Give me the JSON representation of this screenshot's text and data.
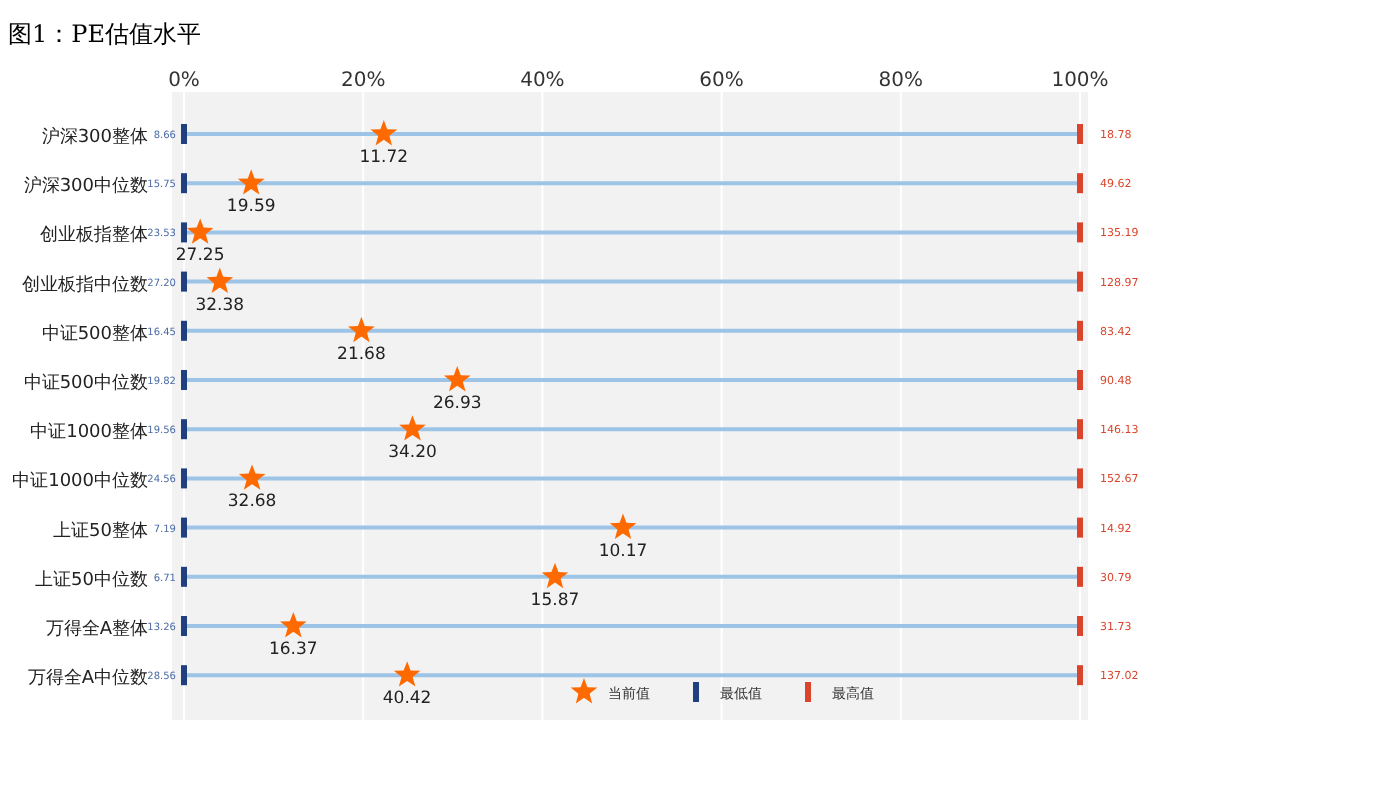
{
  "figure_title": "图1：PE估值水平",
  "chart_data": {
    "type": "scatter",
    "orientation": "horizontal",
    "grid": true,
    "legend": true,
    "xlim": [
      0,
      100
    ],
    "xticks": [
      {
        "value": 0,
        "label": "0%"
      },
      {
        "value": 20,
        "label": "20%"
      },
      {
        "value": 40,
        "label": "40%"
      },
      {
        "value": 60,
        "label": "60%"
      },
      {
        "value": 80,
        "label": "80%"
      },
      {
        "value": 100,
        "label": "100%"
      }
    ],
    "categories": [
      "沪深300整体",
      "沪深300中位数",
      "创业板指整体",
      "创业板指中位数",
      "中证500整体",
      "中证500中位数",
      "中证1000整体",
      "中证1000中位数",
      "上证50整体",
      "上证50中位数",
      "万得全A整体",
      "万得全A中位数"
    ],
    "series": [
      {
        "name": "当前值",
        "color": "#ff6a00",
        "values": [
          22.3,
          7.5,
          1.8,
          4.0,
          19.8,
          30.5,
          25.5,
          7.6,
          49.0,
          41.4,
          12.2,
          24.9
        ]
      },
      {
        "name": "最低值",
        "color": "#1f3f7f",
        "values": [
          0,
          0,
          0,
          0,
          0,
          0,
          0,
          0,
          0,
          0,
          0,
          0
        ]
      },
      {
        "name": "最高值",
        "color": "#d9442a",
        "values": [
          100,
          100,
          100,
          100,
          100,
          100,
          100,
          100,
          100,
          100,
          100,
          100
        ]
      }
    ],
    "value_labels": [
      [
        "11.72",
        "19.59",
        "27.25",
        "32.38",
        "21.68",
        "26.93",
        "34.20",
        "32.68",
        "10.17",
        "15.87",
        "16.37",
        "40.42"
      ],
      [
        "8.66",
        "15.75",
        "23.53",
        "27.20",
        "16.45",
        "19.82",
        "19.56",
        "24.56",
        "7.19",
        "6.71",
        "13.26",
        "28.56"
      ],
      [
        "18.78",
        "49.62",
        "135.19",
        "128.97",
        "83.42",
        "90.48",
        "146.13",
        "152.67",
        "14.92",
        "30.79",
        "31.73",
        "137.02"
      ]
    ]
  }
}
